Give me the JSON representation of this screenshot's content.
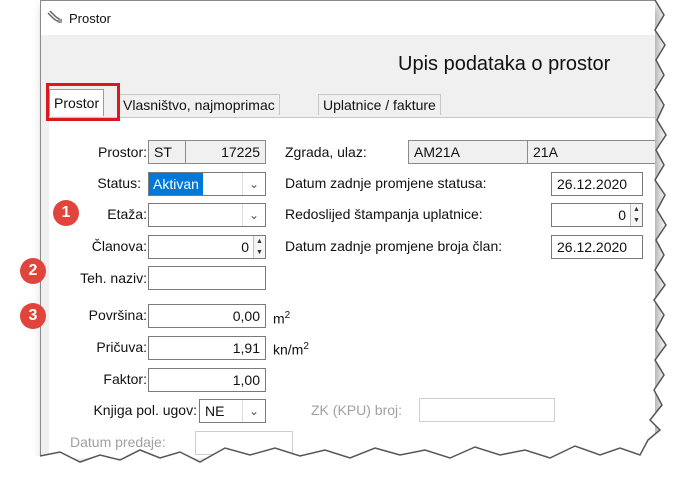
{
  "window": {
    "title": "Prostor",
    "heading": "Upis podataka o prostor"
  },
  "tabs": [
    {
      "label": "Prostor",
      "active": true
    },
    {
      "label": "Vlasništvo, najmoprimac",
      "active": false
    },
    {
      "label": "Uplatnice / fakture",
      "active": false
    }
  ],
  "form": {
    "prostor": {
      "label": "Prostor:",
      "code": "ST",
      "number": "17225"
    },
    "zgrada": {
      "label": "Zgrada, ulaz:",
      "code": "AM21A",
      "entrance": "21A"
    },
    "status": {
      "label": "Status:",
      "value": "Aktivan"
    },
    "datum_status": {
      "label": "Datum zadnje promjene statusa:",
      "value": "26.12.2020"
    },
    "etaza": {
      "label": "Etaža:",
      "value": ""
    },
    "redoslijed": {
      "label": "Redoslijed štampanja uplatnice:",
      "value": "0"
    },
    "clanova": {
      "label": "Članova:",
      "value": "0"
    },
    "datum_clan": {
      "label": "Datum zadnje promjene broja član:",
      "value": "26.12.2020"
    },
    "teh_naziv": {
      "label": "Teh. naziv:",
      "value": ""
    },
    "povrsina": {
      "label": "Površina:",
      "value": "0,00",
      "unit": "m",
      "unit_sup": "2"
    },
    "pricuva": {
      "label": "Pričuva:",
      "value": "1,91",
      "unit": "kn/m",
      "unit_sup": "2"
    },
    "faktor": {
      "label": "Faktor:",
      "value": "1,00"
    },
    "knjiga": {
      "label": "Knjiga pol. ugov:",
      "value": "NE"
    },
    "zk": {
      "label": "ZK (KPU) broj:",
      "value": ""
    },
    "datum_predaje": {
      "label": "Datum predaje:",
      "value": ""
    }
  },
  "callouts": [
    "1",
    "2",
    "3"
  ],
  "colors": {
    "callout": "#e0443a",
    "highlight": "#d9191c",
    "selection": "#0078d7"
  }
}
